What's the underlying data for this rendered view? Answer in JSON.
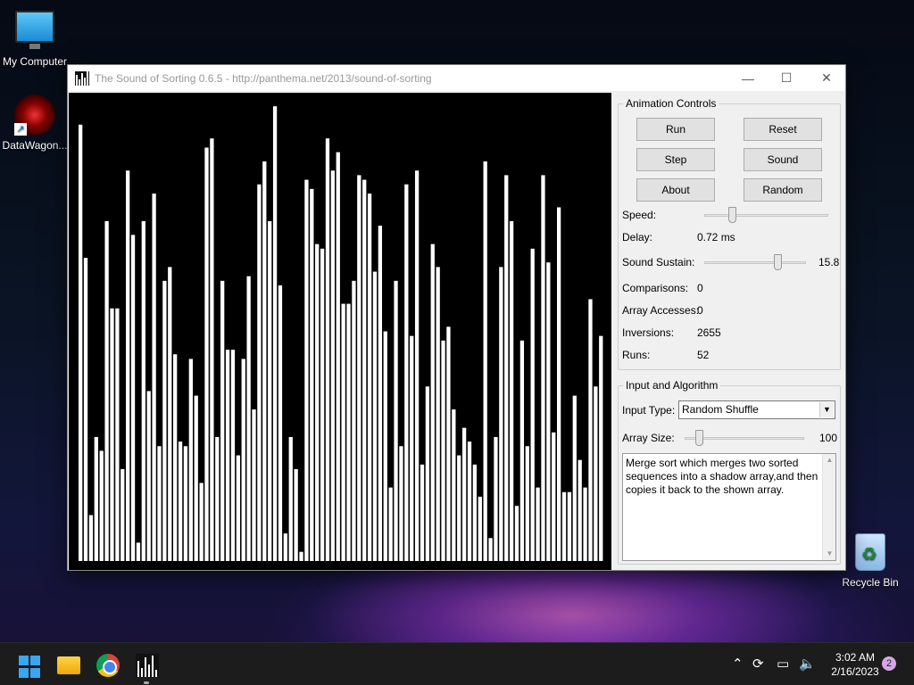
{
  "desktop": {
    "icons": [
      {
        "label": "My Computer"
      },
      {
        "label": "DataWagon..."
      },
      {
        "label": "Recycle Bin"
      }
    ]
  },
  "window": {
    "title": "The Sound of Sorting 0.6.5 - http://panthema.net/2013/sound-of-sorting",
    "controls": {
      "minimize": "—",
      "maximize": "☐",
      "close": "✕"
    }
  },
  "animation_controls": {
    "legend": "Animation Controls",
    "buttons": {
      "run": "Run",
      "reset": "Reset",
      "step": "Step",
      "sound": "Sound",
      "about": "About",
      "random": "Random"
    },
    "speed_label": "Speed:",
    "speed_level": 0.22,
    "delay_label": "Delay:",
    "delay_value": "0.72 ms",
    "sustain_label": "Sound Sustain:",
    "sustain_value": "15.8",
    "sustain_level": 0.72,
    "comparisons_label": "Comparisons:",
    "comparisons_value": "0",
    "accesses_label": "Array Accesses:",
    "accesses_value": "0",
    "inversions_label": "Inversions:",
    "inversions_value": "2655",
    "runs_label": "Runs:",
    "runs_value": "52"
  },
  "input_algorithm": {
    "legend": "Input and Algorithm",
    "input_type_label": "Input Type:",
    "input_type_value": "Random Shuffle",
    "array_size_label": "Array Size:",
    "array_size_value": "100",
    "array_size_level": 0.12,
    "description": "Merge sort which merges two sorted sequences into a shadow array,and then copies it back to the shown array."
  },
  "array_values": [
    95,
    66,
    10,
    27,
    24,
    74,
    55,
    55,
    20,
    85,
    71,
    4,
    74,
    37,
    80,
    25,
    61,
    64,
    45,
    26,
    25,
    44,
    36,
    17,
    90,
    92,
    27,
    61,
    46,
    46,
    23,
    44,
    62,
    33,
    82,
    87,
    74,
    99,
    60,
    6,
    27,
    20,
    2,
    83,
    81,
    69,
    68,
    92,
    85,
    89,
    56,
    56,
    61,
    84,
    83,
    80,
    63,
    73,
    50,
    16,
    61,
    25,
    82,
    49,
    85,
    21,
    38,
    69,
    64,
    48,
    51,
    33,
    23,
    29,
    26,
    21,
    14,
    87,
    5,
    27,
    64,
    84,
    74,
    12,
    48,
    25,
    68,
    16,
    84,
    65,
    28,
    77,
    15,
    15,
    36,
    22,
    16,
    57,
    38,
    49
  ],
  "taskbar": {
    "time": "3:02 AM",
    "date": "2/16/2023",
    "notifications": "2"
  }
}
